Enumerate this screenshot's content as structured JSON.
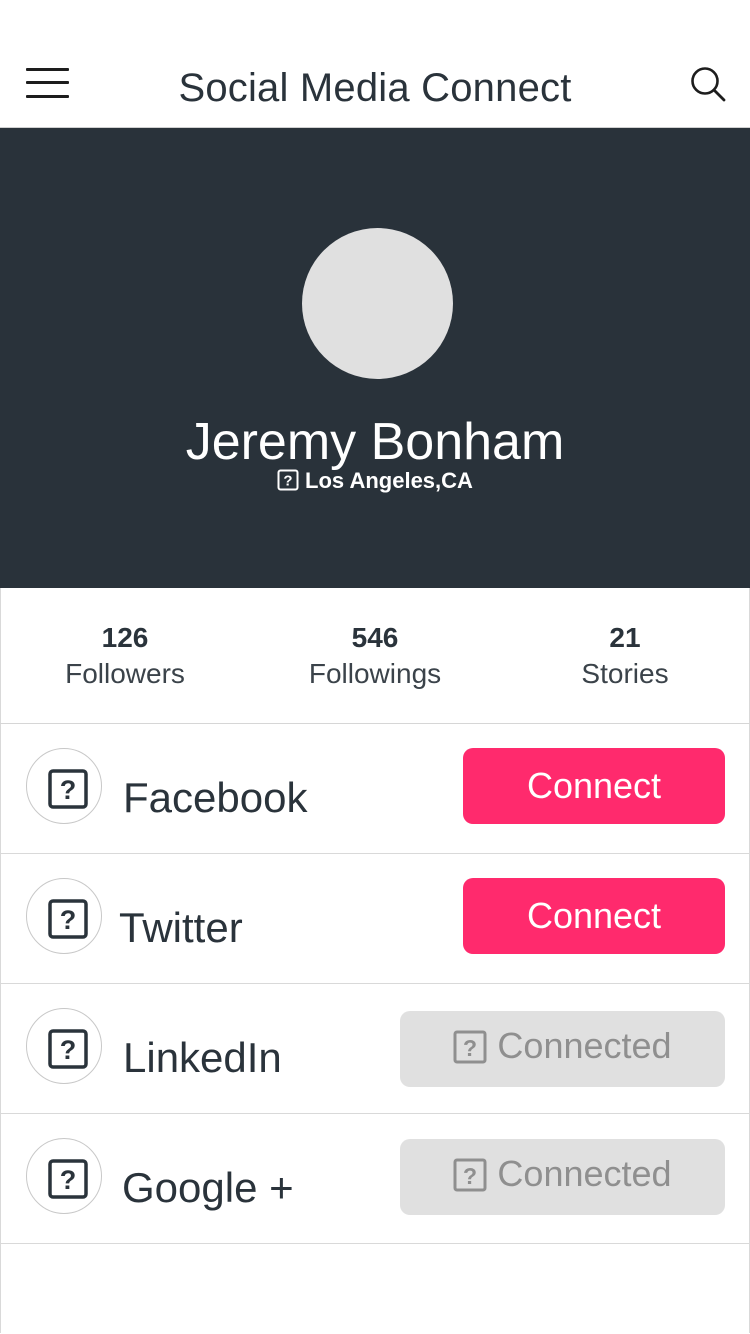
{
  "header": {
    "title": "Social Media Connect",
    "menu_icon": "hamburger-menu-icon",
    "search_icon": "search-icon"
  },
  "profile": {
    "name": "Jeremy Bonham",
    "location": "Los Angeles,CA",
    "location_icon": "placeholder-icon"
  },
  "stats": [
    {
      "value": "126",
      "label": "Followers"
    },
    {
      "value": "546",
      "label": "Followings"
    },
    {
      "value": "21",
      "label": "Stories"
    }
  ],
  "networks": [
    {
      "name": "Facebook",
      "status": "Connect",
      "icon": "placeholder-icon"
    },
    {
      "name": "Twitter",
      "status": "Connect",
      "icon": "placeholder-icon"
    },
    {
      "name": "LinkedIn",
      "status": "Connected",
      "icon": "placeholder-icon"
    },
    {
      "name": "Google +",
      "status": "Connected",
      "icon": "placeholder-icon"
    }
  ],
  "colors": {
    "hero_bg": "#29323a",
    "connect_btn": "#ff2a6d",
    "connected_btn": "#e0e0e0",
    "text": "#2a333b"
  }
}
